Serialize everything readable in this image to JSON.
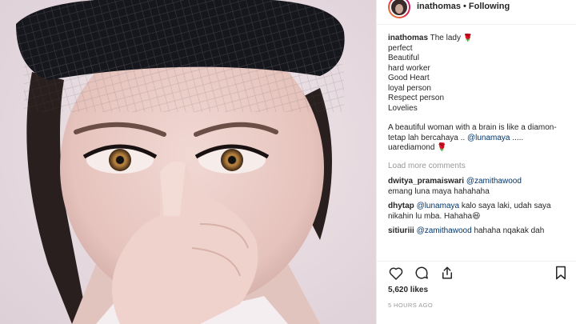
{
  "post": {
    "username": "inathomas",
    "separator": "•",
    "follow_status": "Following"
  },
  "caption": {
    "username": "inathomas",
    "lines": [
      "The lady 🌹",
      "perfect",
      "Beautiful",
      "hard worker",
      "Good Heart",
      "loyal person",
      "Respect person",
      "Lovelies"
    ],
    "quote_before": "A beautiful woman with a brain is like a diamon- tetap lah bercahaya .. ",
    "quote_mention": "@lunamaya",
    "quote_after": "..... uarediamond 🌹"
  },
  "load_more": "Load more comments",
  "comments": [
    {
      "username": "dwitya_pramaiswari",
      "mention": "@zamithawood",
      "text": "emang luna maya hahahaha"
    },
    {
      "username": "dhytap",
      "mention": "@lunamaya",
      "text": "kalo saya laki, udah saya nikahin lu mba. Hahaha😆"
    },
    {
      "username": "sitiuriii",
      "mention": "@zamithawood",
      "text": "hahaha nqakak dah"
    }
  ],
  "actions": {
    "like_icon": "heart-icon",
    "comment_icon": "comment-bubble-icon",
    "share_icon": "share-icon",
    "save_icon": "bookmark-icon"
  },
  "likes": "5,620 likes",
  "timestamp": "5 HOURS AGO",
  "colors": {
    "mention": "#003569",
    "muted": "#999999",
    "text": "#262626",
    "photo_background": "#e9dde2"
  }
}
